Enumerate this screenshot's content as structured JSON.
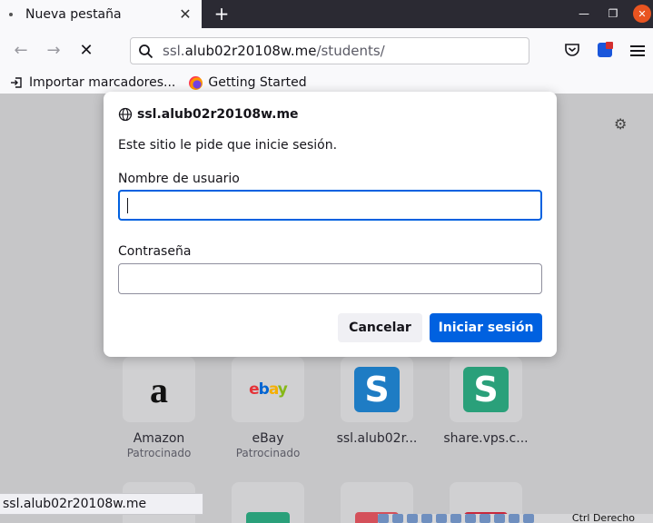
{
  "tab": {
    "title": "Nueva pestaña",
    "close_icon": "close-icon"
  },
  "toolbar": {
    "new_tab_glyph": "+"
  },
  "urlbar": {
    "prefix": "ssl.",
    "host": "alub02r20108w.me",
    "path": "/students/"
  },
  "bookmarks": [
    {
      "label": "Importar marcadores...",
      "icon": "import-icon"
    },
    {
      "label": "Getting Started",
      "icon": "firefox-icon"
    }
  ],
  "dialog": {
    "host": "ssl.alub02r20108w.me",
    "message": "Este sitio le pide que inicie sesión.",
    "username_label": "Nombre de usuario",
    "username_value": "",
    "password_label": "Contraseña",
    "password_value": "",
    "cancel_label": "Cancelar",
    "submit_label": "Iniciar sesión"
  },
  "top_sites": [
    {
      "label": "Amazon",
      "sub": "Patrocinado"
    },
    {
      "label": "eBay",
      "sub": "Patrocinado"
    },
    {
      "label": "ssl.alub02r...",
      "sub": ""
    },
    {
      "label": "share.vps.c...",
      "sub": ""
    }
  ],
  "status_bar": {
    "text": "ssl.alub02r20108w.me"
  },
  "system_tray": {
    "text": "Ctrl Derecho"
  },
  "colors": {
    "accent": "#0061e0",
    "close_button": "#e95420",
    "tab_strip": "#2b2a33",
    "share_logo": "#2aa07a",
    "ssl_logo": "#1e7cc4"
  }
}
